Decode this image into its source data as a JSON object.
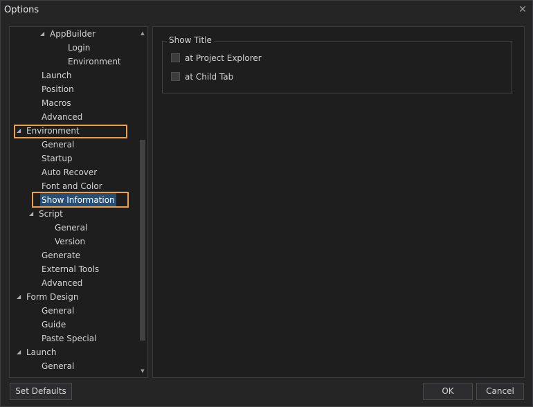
{
  "window": {
    "title": "Options"
  },
  "tree": {
    "items": [
      {
        "label": "AppBuilder",
        "expanded": true
      },
      {
        "label": "Login"
      },
      {
        "label": "Environment"
      },
      {
        "label": "Launch"
      },
      {
        "label": "Position"
      },
      {
        "label": "Macros"
      },
      {
        "label": "Advanced"
      },
      {
        "label": "Environment",
        "expanded": true
      },
      {
        "label": "General"
      },
      {
        "label": "Startup"
      },
      {
        "label": "Auto Recover"
      },
      {
        "label": "Font and Color"
      },
      {
        "label": "Show Information",
        "selected": true
      },
      {
        "label": "Script",
        "expanded": true
      },
      {
        "label": "General"
      },
      {
        "label": "Version"
      },
      {
        "label": "Generate"
      },
      {
        "label": "External Tools"
      },
      {
        "label": "Advanced"
      },
      {
        "label": "Form Design",
        "expanded": true
      },
      {
        "label": "General"
      },
      {
        "label": "Guide"
      },
      {
        "label": "Paste Special"
      },
      {
        "label": "Launch",
        "expanded": true
      },
      {
        "label": "General"
      }
    ]
  },
  "group": {
    "title": "Show Title",
    "options": [
      {
        "label": "at Project Explorer",
        "checked": false
      },
      {
        "label": "at Child Tab",
        "checked": false
      }
    ]
  },
  "buttons": {
    "set_defaults": "Set Defaults",
    "ok": "OK",
    "cancel": "Cancel"
  },
  "colors": {
    "background": "#252526",
    "panel": "#1e1e1e",
    "selection": "#264f78",
    "highlight_box": "#f0a04b"
  }
}
